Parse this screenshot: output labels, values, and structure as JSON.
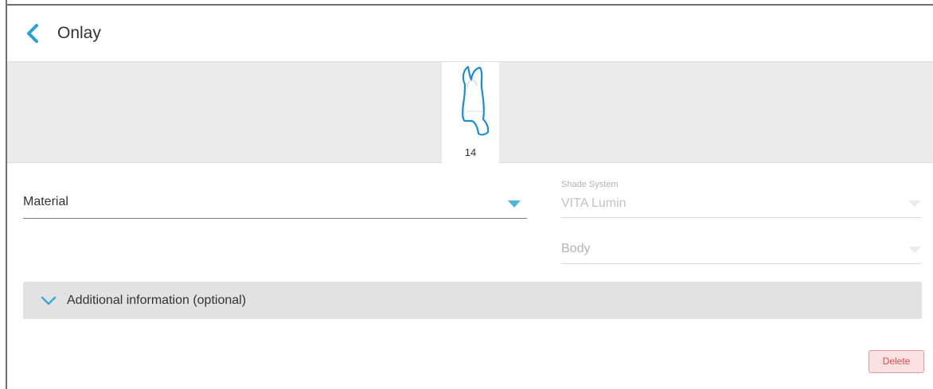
{
  "header": {
    "title": "Onlay",
    "back_icon": "chevron-left-icon"
  },
  "tooth": {
    "number": "14",
    "icon": "tooth-icon"
  },
  "material": {
    "label": "Material",
    "arrow_icon": "dropdown-arrow-icon"
  },
  "shade_system": {
    "caption": "Shade System",
    "value": "VITA Lumin"
  },
  "body_shade": {
    "value": "Body"
  },
  "additional_info": {
    "label": "Additional information (optional)",
    "icon": "chevron-down-icon"
  },
  "actions": {
    "delete_label": "Delete"
  },
  "colors": {
    "accent": "#4fb3de",
    "tooth_outline": "#1a8fd6",
    "delete_text": "#dc4d4d",
    "delete_bg": "#fbe1e1",
    "panel_bg": "#e2e2e2",
    "strip_bg": "#ebebeb"
  }
}
